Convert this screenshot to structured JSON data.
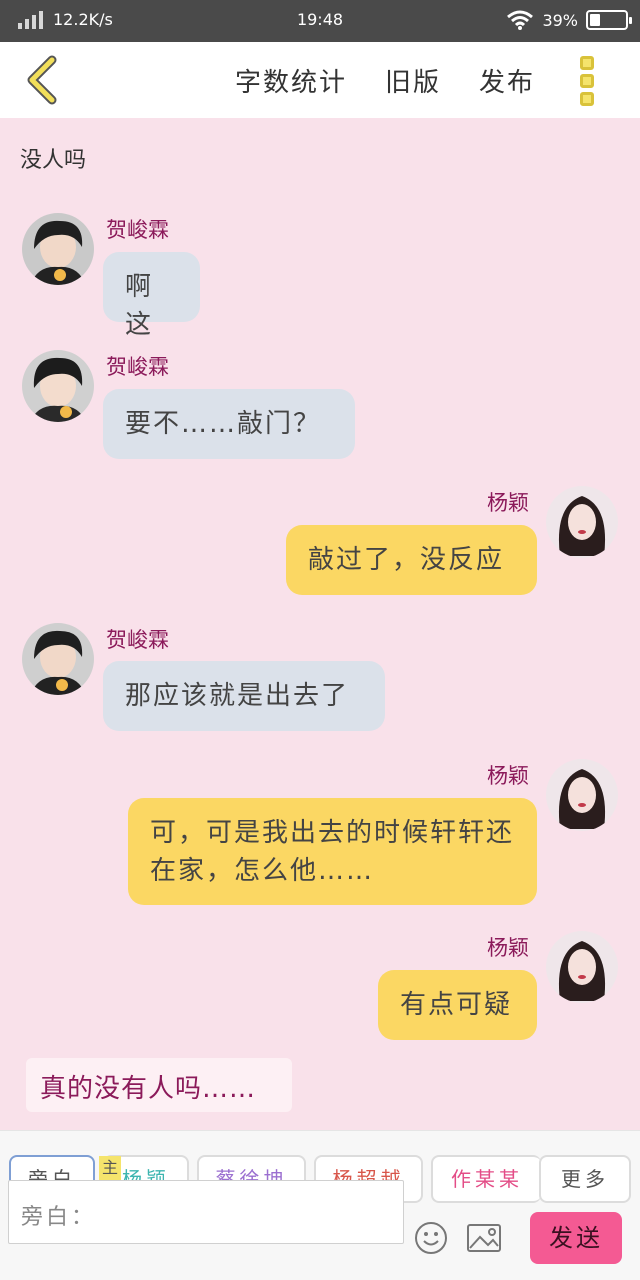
{
  "status_bar": {
    "net_speed": "12.2K/s",
    "time": "19:48",
    "battery": "39%"
  },
  "nav": {
    "links": [
      "字数统计",
      "旧版",
      "发布"
    ]
  },
  "chat": {
    "narration_top": "没人吗",
    "messages": [
      {
        "side": "left",
        "name": "贺峻霖",
        "text": "啊这"
      },
      {
        "side": "left",
        "name": "贺峻霖",
        "text": "要不……敲门？"
      },
      {
        "side": "right",
        "name": "杨颖",
        "text": "敲过了，没反应"
      },
      {
        "side": "left",
        "name": "贺峻霖",
        "text": "那应该就是出去了"
      },
      {
        "side": "right",
        "name": "杨颖",
        "text": "可，可是我出去的时候轩轩还在家，怎么他……"
      },
      {
        "side": "right",
        "name": "杨颖",
        "text": "有点可疑"
      }
    ],
    "narration_bottom": "真的没有人吗……"
  },
  "toolbar": {
    "chips": [
      "旁白",
      "杨颖",
      "蔡徐坤",
      "杨超越",
      "作某某"
    ],
    "chip_colors": [
      "#555555",
      "#3db5b0",
      "#9b6fd0",
      "#d8564a",
      "#e34d87"
    ],
    "main_tag": "主",
    "more": "更多",
    "input_placeholder": "旁白：",
    "send": "发送"
  }
}
